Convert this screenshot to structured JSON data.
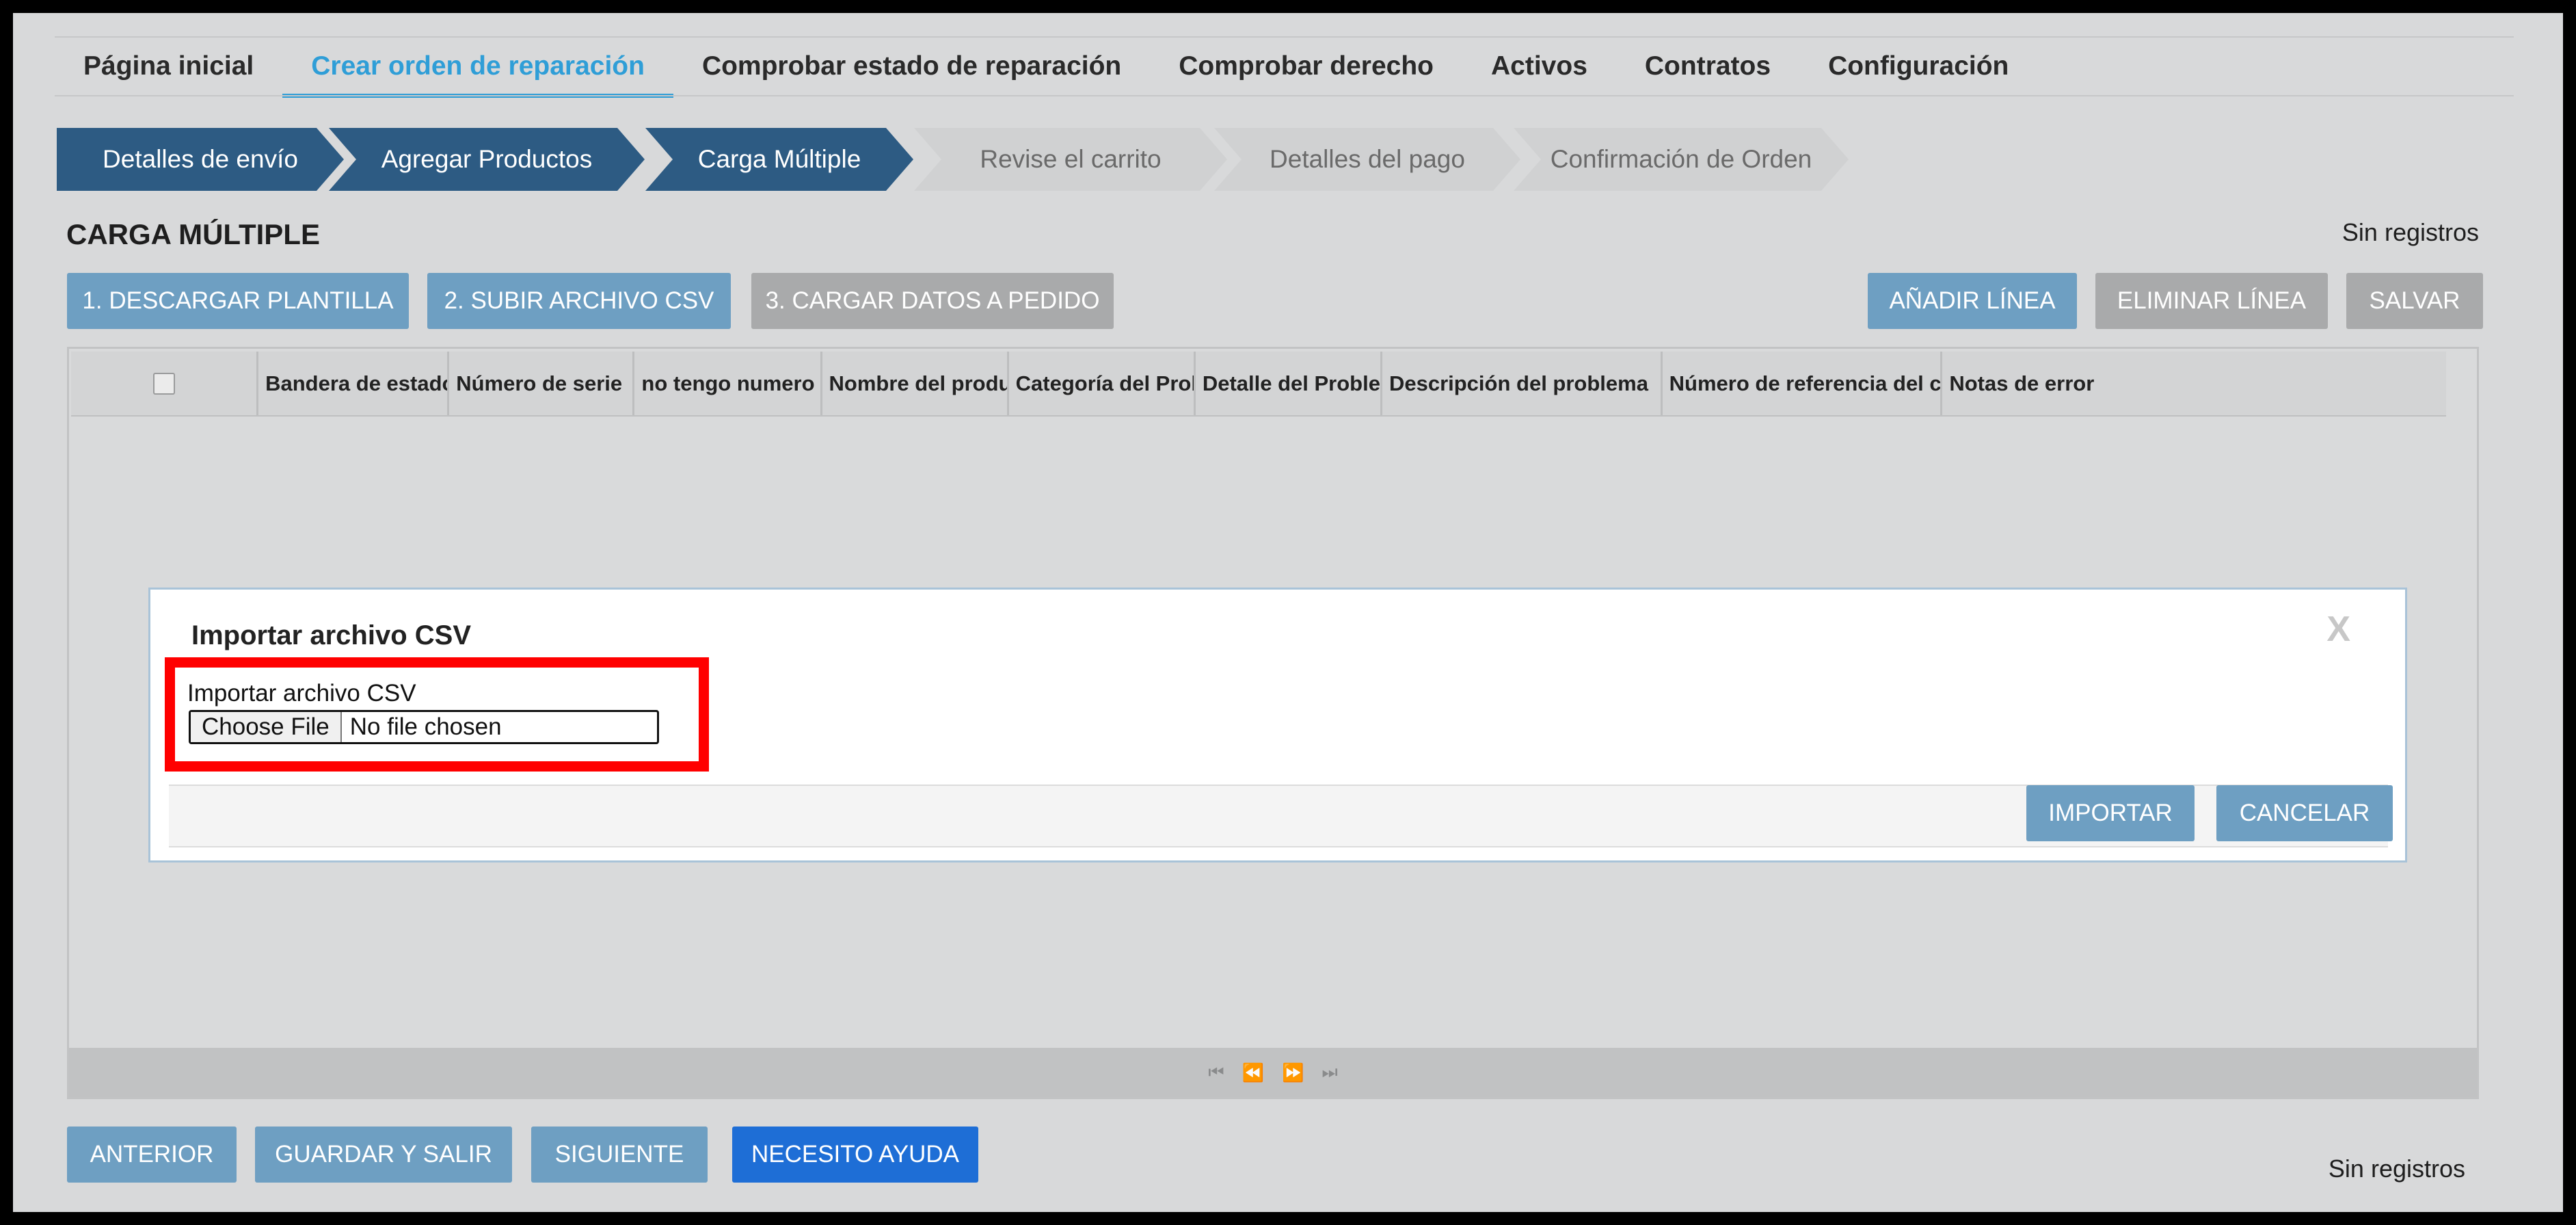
{
  "nav": {
    "items": [
      {
        "label": "Página inicial",
        "active": false
      },
      {
        "label": "Crear orden de reparación",
        "active": true
      },
      {
        "label": "Comprobar estado de reparación",
        "active": false
      },
      {
        "label": "Comprobar derecho",
        "active": false
      },
      {
        "label": "Activos",
        "active": false
      },
      {
        "label": "Contratos",
        "active": false
      },
      {
        "label": "Configuración",
        "active": false
      }
    ]
  },
  "steps": [
    {
      "label": "Detalles de envío",
      "state": "done"
    },
    {
      "label": "Agregar Productos",
      "state": "done"
    },
    {
      "label": "Carga Múltiple",
      "state": "done"
    },
    {
      "label": "Revise el carrito",
      "state": "todo"
    },
    {
      "label": "Detalles del pago",
      "state": "todo"
    },
    {
      "label": "Confirmación de Orden",
      "state": "todo"
    }
  ],
  "section": {
    "title": "CARGA MÚLTIPLE",
    "records": "Sin registros"
  },
  "toolbar": {
    "download_template": "1. DESCARGAR PLANTILLA",
    "upload_csv": "2. SUBIR ARCHIVO CSV",
    "load_to_order": "3. CARGAR DATOS A PEDIDO",
    "add_line": "AÑADIR LÍNEA",
    "delete_line": "ELIMINAR LÍNEA",
    "save": "SALVAR"
  },
  "grid": {
    "columns": [
      "Bandera de estado",
      "Número de serie",
      "no tengo numero de serie",
      "Nombre del producto",
      "Categoría del Problema",
      "Detalle del Problema",
      "Descripción del problema",
      "Número de referencia del cliente",
      "Notas de error"
    ],
    "pager": [
      "⏮",
      "⏪",
      "⏩",
      "⏭"
    ]
  },
  "modal": {
    "title": "Importar archivo CSV",
    "close": "X",
    "field_label": "Importar archivo CSV",
    "choose_file": "Choose File",
    "file_status": "No file chosen",
    "import_button": "IMPORTAR",
    "cancel_button": "CANCELAR"
  },
  "footer": {
    "previous": "ANTERIOR",
    "save_exit": "GUARDAR Y SALIR",
    "next": "SIGUIENTE",
    "help": "NECESITO AYUDA",
    "records": "Sin registros"
  },
  "colors": {
    "active_nav": "#2f9ed7",
    "step_done": "#2d5b83",
    "button_blue": "#6e9fc2",
    "button_disabled": "#a9aaab",
    "help_button": "#1e6ed6",
    "highlight": "#ff0000"
  }
}
